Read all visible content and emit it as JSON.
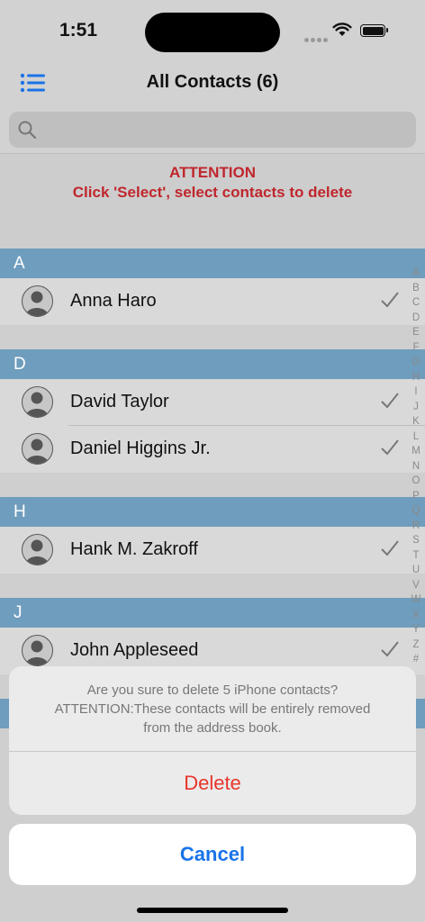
{
  "status": {
    "time": "1:51"
  },
  "nav": {
    "title": "All Contacts (6)"
  },
  "search": {
    "placeholder": ""
  },
  "attention": {
    "line1": "ATTENTION",
    "line2": "Click 'Select', select contacts to delete"
  },
  "sections": [
    {
      "letter": "A",
      "contacts": [
        "Anna Haro"
      ]
    },
    {
      "letter": "D",
      "contacts": [
        "David Taylor",
        "Daniel Higgins Jr."
      ]
    },
    {
      "letter": "H",
      "contacts": [
        "Hank M. Zakroff"
      ]
    },
    {
      "letter": "J",
      "contacts": [
        "John Appleseed"
      ]
    }
  ],
  "index_letters": [
    "A",
    "B",
    "C",
    "D",
    "E",
    "F",
    "G",
    "H",
    "I",
    "J",
    "K",
    "L",
    "M",
    "N",
    "O",
    "P",
    "Q",
    "R",
    "S",
    "T",
    "U",
    "V",
    "W",
    "X",
    "Y",
    "Z",
    "#"
  ],
  "sheet": {
    "message_line1": "Are you sure to delete 5 iPhone contacts?",
    "message_line2": "ATTENTION:These contacts will be entirely removed",
    "message_line3": "from the address book.",
    "delete_label": "Delete",
    "cancel_label": "Cancel"
  },
  "colors": {
    "accent": "#1a73e8",
    "destructive": "#e8352c",
    "section_header": "#6f9dbd",
    "attention": "#c0262d"
  }
}
